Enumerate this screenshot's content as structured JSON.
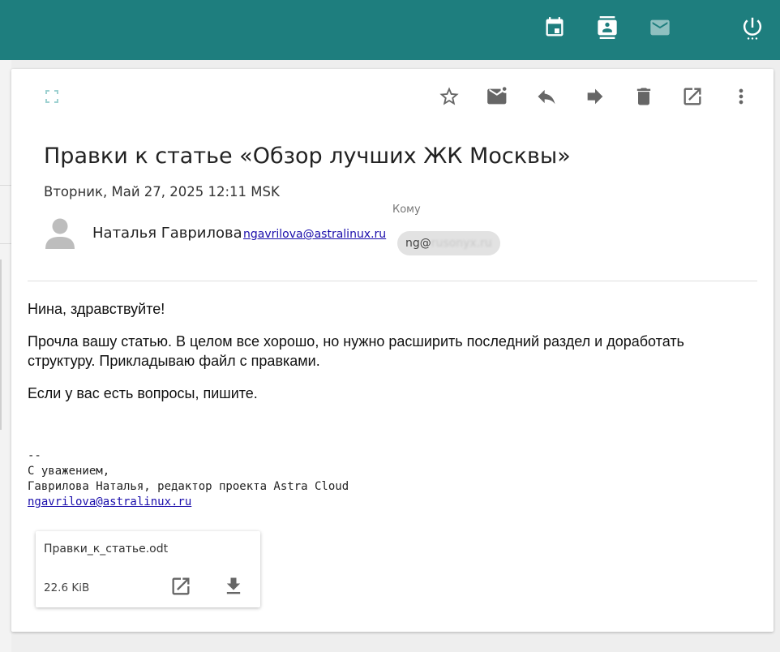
{
  "topbar": {
    "icons": [
      "calendar-icon",
      "contacts-icon",
      "mail-icon",
      "power-icon"
    ],
    "color": "#1e7e7e"
  },
  "toolbar": {
    "icons": [
      "fullscreen-icon",
      "star-icon",
      "mark-unread-icon",
      "reply-icon",
      "forward-icon",
      "delete-icon",
      "open-external-icon",
      "more-vert-icon"
    ]
  },
  "message": {
    "subject": "Правки к статье «Обзор лучших ЖК Москвы»",
    "date": "Вторник, Май 27, 2025 12:11 MSK",
    "sender": {
      "name": "Наталья Гаврилова",
      "email": "ngavrilova@astralinux.ru"
    },
    "to_label": "Кому",
    "recipient": {
      "visible": "ng@",
      "blurred": "rusonyx.ru"
    },
    "body": [
      "Нина, здравствуйте!",
      "Прочла вашу статью. В целом все хорошо, но нужно расширить последний раздел и доработать структуру. Прикладываю файл с правками.",
      "Если у вас есть вопросы, пишите."
    ],
    "signature": {
      "separator": "--",
      "greeting": "С уважением,",
      "line": "Гаврилова Наталья, редактор проекта Astra Cloud",
      "email": "ngavrilova@astralinux.ru"
    }
  },
  "attachment": {
    "name": "Правки_к_статье.odt",
    "size": "22.6 KiB",
    "icons": [
      "open-external-icon",
      "download-icon"
    ]
  }
}
